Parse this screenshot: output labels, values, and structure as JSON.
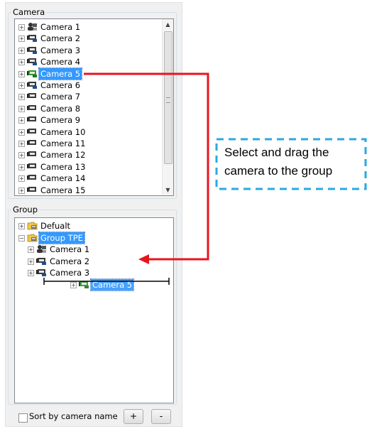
{
  "camera_section": {
    "title": "Camera",
    "items": [
      {
        "label": "Camera 1",
        "icon": "camera-person-icon"
      },
      {
        "label": "Camera 2",
        "icon": "ip-camera-icon"
      },
      {
        "label": "Camera 3",
        "icon": "ip-camera-icon"
      },
      {
        "label": "Camera 4",
        "icon": "ip-camera-icon"
      },
      {
        "label": "Camera 5",
        "icon": "ip-camera-green-icon",
        "selected": true
      },
      {
        "label": "Camera 6",
        "icon": "ip-camera-icon"
      },
      {
        "label": "Camera 7",
        "icon": "camera-icon"
      },
      {
        "label": "Camera 8",
        "icon": "camera-icon"
      },
      {
        "label": "Camera 9",
        "icon": "camera-icon"
      },
      {
        "label": "Camera 10",
        "icon": "camera-icon"
      },
      {
        "label": "Camera 11",
        "icon": "camera-icon"
      },
      {
        "label": "Camera 12",
        "icon": "camera-icon"
      },
      {
        "label": "Camera 13",
        "icon": "camera-icon"
      },
      {
        "label": "Camera 14",
        "icon": "camera-icon"
      },
      {
        "label": "Camera 15",
        "icon": "camera-icon"
      }
    ]
  },
  "group_section": {
    "title": "Group",
    "groups": [
      {
        "label": "Defualt",
        "icon": "folder-icon",
        "expanded": false
      },
      {
        "label": "Group TPE",
        "icon": "folder-icon",
        "expanded": true,
        "selected": true,
        "children": [
          {
            "label": "Camera 1",
            "icon": "camera-person-icon"
          },
          {
            "label": "Camera 2",
            "icon": "ip-camera-icon"
          },
          {
            "label": "Camera 3",
            "icon": "ip-camera-icon"
          }
        ]
      }
    ],
    "dragged_item": {
      "label": "Camera 5",
      "icon": "ip-camera-green-icon"
    }
  },
  "footer": {
    "sort_label": "Sort by camera name",
    "sort_checked": false,
    "add_label": "+",
    "remove_label": "-"
  },
  "instruction": {
    "line1": "Select and drag the",
    "line2": "camera to the group"
  },
  "colors": {
    "arrow": "#e8141c",
    "callout_border": "#29a9e1",
    "selection": "#3399ff"
  }
}
